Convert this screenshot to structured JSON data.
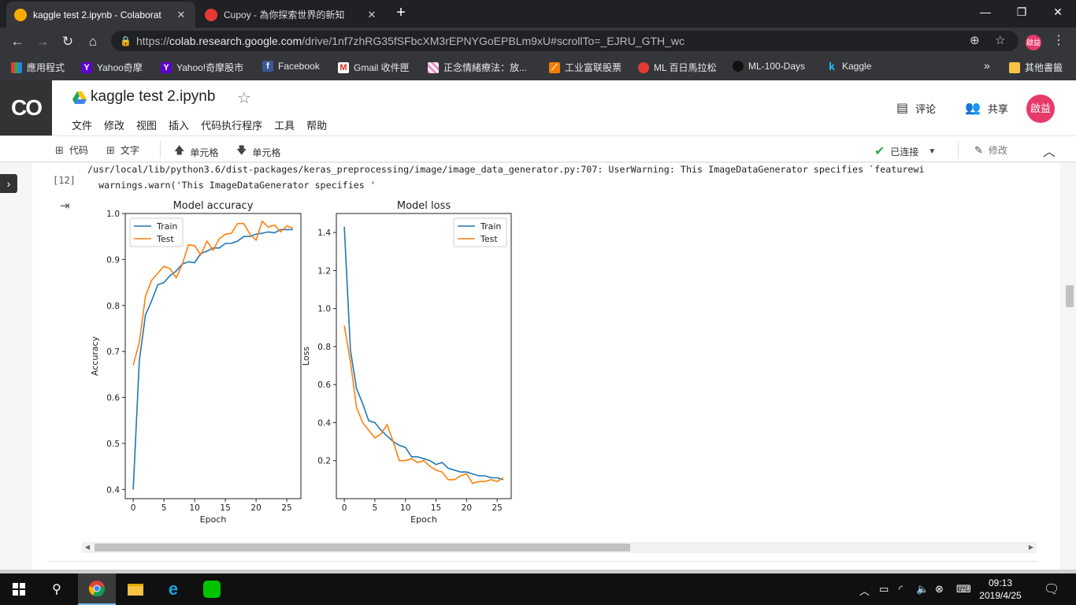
{
  "browser": {
    "tabs": [
      {
        "title": "kaggle test 2.ipynb - Colaborat",
        "icon": "colab-icon",
        "active": true
      },
      {
        "title": "Cupoy - 為你探索世界的新知",
        "icon": "cupoy-icon",
        "active": false
      }
    ],
    "url_scheme": "https://",
    "url_host": "colab.research.google.com",
    "url_path": "/drive/1nf7zhRG35fSFbcXM3rEPNYGoEPBLm9xU#scrollTo=_EJRU_GTH_wc",
    "profile_initials": "啟益",
    "bookmarks": [
      {
        "label": "應用程式",
        "icon": "apps-grid-icon"
      },
      {
        "label": "Yahoo奇摩",
        "icon": "yahoo-icon"
      },
      {
        "label": "Yahoo!奇摩股市",
        "icon": "yahoo-icon"
      },
      {
        "label": "Facebook",
        "icon": "facebook-icon"
      },
      {
        "label": "Gmail 收件匣",
        "icon": "gmail-icon"
      },
      {
        "label": "正念情緒療法：放...",
        "icon": "pattern-icon"
      },
      {
        "label": "工业富联股票",
        "icon": "stock-icon"
      },
      {
        "label": "ML 百日馬拉松",
        "icon": "cupoy-icon"
      },
      {
        "label": "ML-100-Days",
        "icon": "github-icon"
      },
      {
        "label": "Kaggle",
        "icon": "kaggle-icon"
      }
    ],
    "bookmarks_more": "»",
    "other_bookmarks": "其他書籤"
  },
  "colab": {
    "logo": "CO",
    "notebook_title": "kaggle test 2.ipynb",
    "menu": [
      "文件",
      "修改",
      "视图",
      "插入",
      "代码执行程序",
      "工具",
      "帮助"
    ],
    "comment_label": "评论",
    "share_label": "共享",
    "avatar_initials": "啟益",
    "toolbar": {
      "code_label": "代码",
      "text_label": "文字",
      "cell_up_label": "单元格",
      "cell_down_label": "单元格",
      "connected_label": "已连接",
      "edit_label": "修改"
    },
    "cell": {
      "exec_count": "[12]",
      "warning_line1": "/usr/local/lib/python3.6/dist-packages/keras_preprocessing/image/image_data_generator.py:707: UserWarning: This ImageDataGenerator specifies `featurewi",
      "warning_line2": "  warnings.warn('This ImageDataGenerator specifies '"
    }
  },
  "chart_data": [
    {
      "type": "line",
      "title": "Model accuracy",
      "xlabel": "Epoch",
      "ylabel": "Accuracy",
      "xlim": [
        -1.3,
        27.3
      ],
      "ylim": [
        0.38,
        1.0
      ],
      "xticks": [
        0,
        5,
        10,
        15,
        20,
        25
      ],
      "yticks": [
        0.4,
        0.5,
        0.6,
        0.7,
        0.8,
        0.9,
        1.0
      ],
      "legend": "upper-left",
      "grid": false,
      "x": [
        0,
        1,
        2,
        3,
        4,
        5,
        6,
        7,
        8,
        9,
        10,
        11,
        12,
        13,
        14,
        15,
        16,
        17,
        18,
        19,
        20,
        21,
        22,
        23,
        24,
        25,
        26
      ],
      "series": [
        {
          "name": "Train",
          "color": "#1f77b4",
          "values": [
            0.4,
            0.68,
            0.78,
            0.81,
            0.845,
            0.85,
            0.865,
            0.875,
            0.89,
            0.895,
            0.893,
            0.913,
            0.918,
            0.925,
            0.925,
            0.935,
            0.935,
            0.94,
            0.95,
            0.95,
            0.955,
            0.957,
            0.96,
            0.958,
            0.965,
            0.965,
            0.965
          ]
        },
        {
          "name": "Test",
          "color": "#ff7f0e",
          "values": [
            0.67,
            0.72,
            0.82,
            0.855,
            0.87,
            0.885,
            0.88,
            0.86,
            0.89,
            0.932,
            0.93,
            0.91,
            0.94,
            0.92,
            0.945,
            0.955,
            0.957,
            0.978,
            0.978,
            0.955,
            0.942,
            0.983,
            0.97,
            0.975,
            0.96,
            0.973,
            0.968
          ]
        }
      ]
    },
    {
      "type": "line",
      "title": "Model loss",
      "xlabel": "Epoch",
      "ylabel": "Loss",
      "xlim": [
        -1.3,
        27.3
      ],
      "ylim": [
        0.0,
        1.5
      ],
      "xticks": [
        0,
        5,
        10,
        15,
        20,
        25
      ],
      "yticks": [
        0.2,
        0.4,
        0.6,
        0.8,
        1.0,
        1.2,
        1.4
      ],
      "legend": "upper-right",
      "grid": false,
      "x": [
        0,
        1,
        2,
        3,
        4,
        5,
        6,
        7,
        8,
        9,
        10,
        11,
        12,
        13,
        14,
        15,
        16,
        17,
        18,
        19,
        20,
        21,
        22,
        23,
        24,
        25,
        26
      ],
      "series": [
        {
          "name": "Train",
          "color": "#1f77b4",
          "values": [
            1.43,
            0.78,
            0.58,
            0.5,
            0.41,
            0.4,
            0.36,
            0.33,
            0.3,
            0.28,
            0.27,
            0.22,
            0.22,
            0.21,
            0.2,
            0.18,
            0.19,
            0.16,
            0.15,
            0.14,
            0.14,
            0.13,
            0.12,
            0.12,
            0.11,
            0.11,
            0.1
          ]
        },
        {
          "name": "Test",
          "color": "#ff7f0e",
          "values": [
            0.91,
            0.72,
            0.48,
            0.4,
            0.36,
            0.32,
            0.34,
            0.39,
            0.3,
            0.2,
            0.2,
            0.21,
            0.19,
            0.2,
            0.17,
            0.15,
            0.14,
            0.1,
            0.1,
            0.12,
            0.13,
            0.08,
            0.09,
            0.09,
            0.1,
            0.09,
            0.11
          ]
        }
      ]
    }
  ],
  "taskbar": {
    "time": "09:13",
    "date": "2019/4/25"
  }
}
